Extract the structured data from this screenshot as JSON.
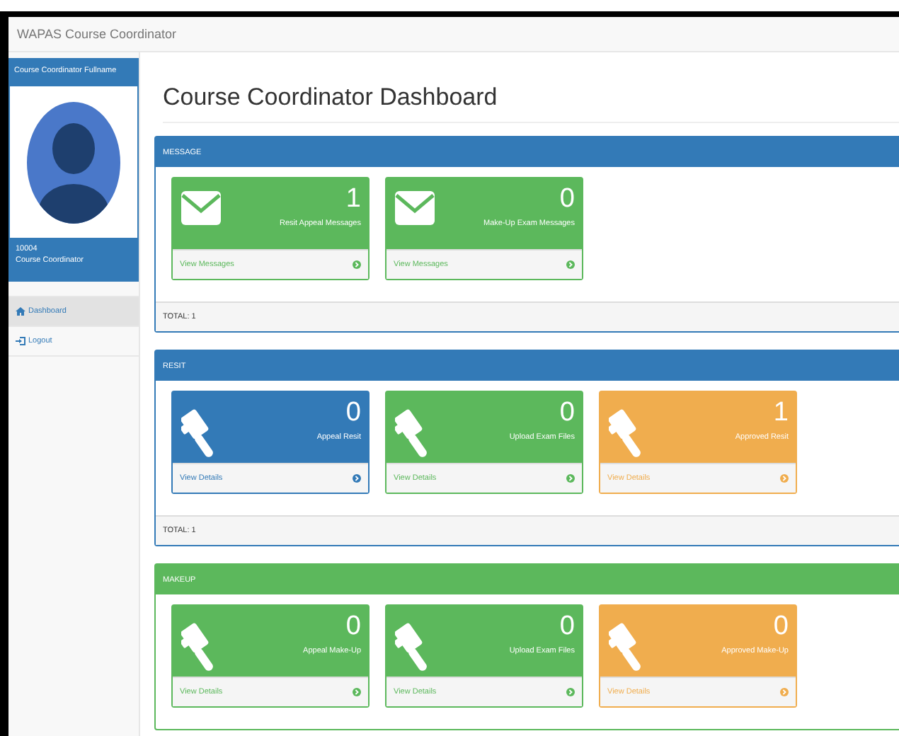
{
  "navbar": {
    "brand": "WAPAS Course Coordinator"
  },
  "profile": {
    "name": "Course Coordinator Fullname",
    "id": "10004",
    "role": "Course Coordinator"
  },
  "sidebar": {
    "items": [
      {
        "label": "Dashboard",
        "kind": "home",
        "selected": true
      },
      {
        "label": "Logout",
        "kind": "signin",
        "selected": false
      }
    ]
  },
  "page_title": "Course Coordinator Dashboard",
  "panels": [
    {
      "title": "MESSAGE",
      "color": "#337ab7",
      "total": "TOTAL: 1",
      "cards": [
        {
          "count": "1",
          "label": "Resit Appeal Messages",
          "link": "View Messages",
          "kind": "envelope",
          "color": "#5cb85c"
        },
        {
          "count": "0",
          "label": "Make-Up Exam Messages",
          "link": "View Messages",
          "kind": "envelope",
          "color": "#5cb85c"
        }
      ]
    },
    {
      "title": "RESIT",
      "color": "#337ab7",
      "total": "TOTAL: 1",
      "cards": [
        {
          "count": "0",
          "label": "Appeal Resit",
          "link": "View Details",
          "kind": "gavel",
          "color": "#337ab7"
        },
        {
          "count": "0",
          "label": "Upload Exam Files",
          "link": "View Details",
          "kind": "gavel",
          "color": "#5cb85c"
        },
        {
          "count": "1",
          "label": "Approved Resit",
          "link": "View Details",
          "kind": "gavel",
          "color": "#f0ad4e"
        }
      ]
    },
    {
      "title": "MAKEUP",
      "color": "#5cb85c",
      "cards": [
        {
          "count": "0",
          "label": "Appeal Make-Up",
          "link": "View Details",
          "kind": "gavel",
          "color": "#5cb85c"
        },
        {
          "count": "0",
          "label": "Upload Exam Files",
          "link": "View Details",
          "kind": "gavel",
          "color": "#5cb85c"
        },
        {
          "count": "0",
          "label": "Approved Make-Up",
          "link": "View Details",
          "kind": "gavel",
          "color": "#f0ad4e"
        }
      ]
    }
  ]
}
